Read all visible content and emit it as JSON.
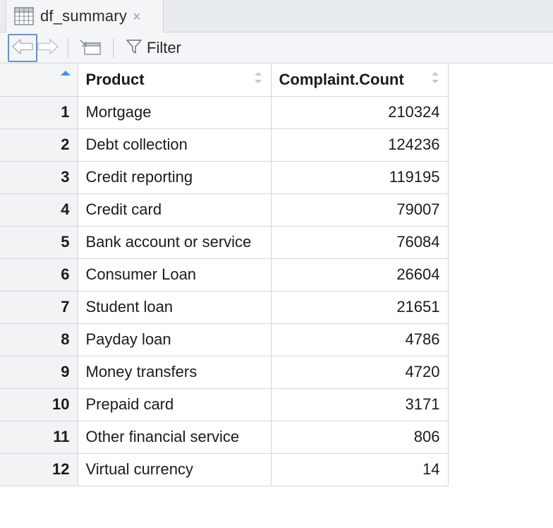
{
  "tab": {
    "title": "df_summary",
    "close_glyph": "×",
    "icon": "table-grid-icon"
  },
  "toolbar": {
    "back_icon": "arrow-left-icon",
    "forward_icon": "arrow-right-icon",
    "popout_icon": "popout-window-icon",
    "filter_icon": "funnel-icon",
    "filter_label": "Filter"
  },
  "table": {
    "columns": [
      "",
      "Product",
      "Complaint.Count"
    ],
    "sorted_column": "row-number",
    "sort_direction": "ascending",
    "rows": [
      {
        "n": "1",
        "product": "Mortgage",
        "count": "210324"
      },
      {
        "n": "2",
        "product": "Debt collection",
        "count": "124236"
      },
      {
        "n": "3",
        "product": "Credit reporting",
        "count": "119195"
      },
      {
        "n": "4",
        "product": "Credit card",
        "count": "79007"
      },
      {
        "n": "5",
        "product": "Bank account or service",
        "count": "76084"
      },
      {
        "n": "6",
        "product": "Consumer Loan",
        "count": "26604"
      },
      {
        "n": "7",
        "product": "Student loan",
        "count": "21651"
      },
      {
        "n": "8",
        "product": "Payday loan",
        "count": "4786"
      },
      {
        "n": "9",
        "product": "Money transfers",
        "count": "4720"
      },
      {
        "n": "10",
        "product": "Prepaid card",
        "count": "3171"
      },
      {
        "n": "11",
        "product": "Other financial service",
        "count": "806"
      },
      {
        "n": "12",
        "product": "Virtual currency",
        "count": "14"
      }
    ]
  },
  "colors": {
    "accent": "#4a90d9",
    "selected_border": "#6f8fc7",
    "chrome_bg": "#f3f5f7"
  }
}
